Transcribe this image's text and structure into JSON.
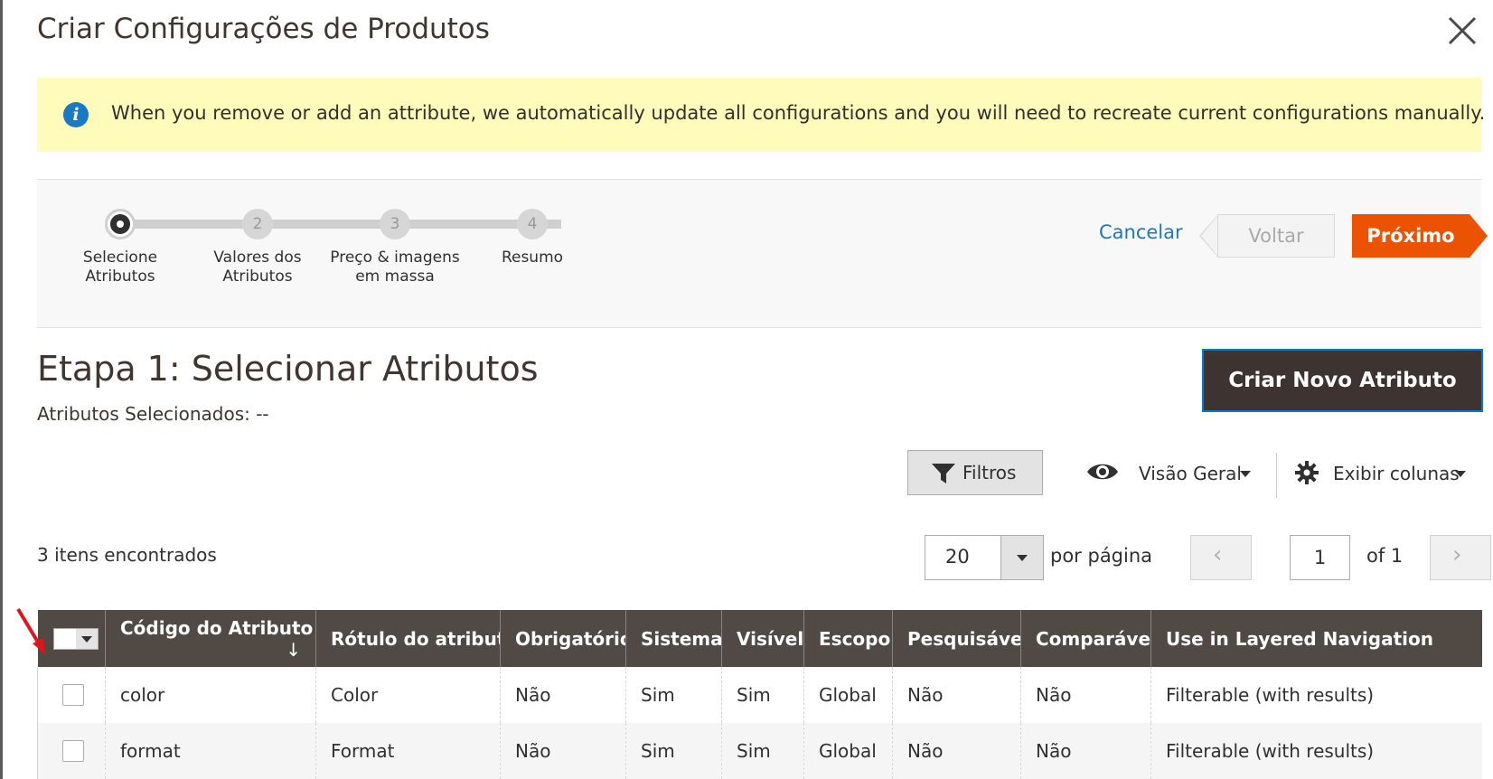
{
  "modal": {
    "title": "Criar Configurações de Produtos"
  },
  "notice": {
    "text": "When you remove or add an attribute, we automatically update all configurations and you will need to recreate current configurations manually."
  },
  "wizard": {
    "steps": [
      {
        "number": "1",
        "label": "Selecione Atributos",
        "active": true
      },
      {
        "number": "2",
        "label": "Valores dos Atributos",
        "active": false
      },
      {
        "number": "3",
        "label": "Preço & imagens em massa",
        "active": false
      },
      {
        "number": "4",
        "label": "Resumo",
        "active": false
      }
    ],
    "cancel_label": "Cancelar",
    "back_label": "Voltar",
    "next_label": "Próximo"
  },
  "step": {
    "title": "Etapa 1: Selecionar Atributos",
    "selected_label": "Atributos Selecionados: --",
    "create_button": "Criar Novo Atributo"
  },
  "toolbar": {
    "filters_label": "Filtros",
    "view_label": "Visão Geral",
    "columns_label": "Exibir colunas"
  },
  "pager": {
    "records": "3 itens encontrados",
    "per_page_value": "20",
    "per_page_label": "por página",
    "current_page": "1",
    "total_pages": "of 1"
  },
  "grid": {
    "columns": [
      "Código do Atributo",
      "Rótulo do atributo",
      "Obrigatório",
      "Sistema",
      "Visível",
      "Escopo",
      "Pesquisável",
      "Comparável",
      "Use in Layered Navigation"
    ],
    "sort_indicator": "↓",
    "rows": [
      [
        "color",
        "Color",
        "Não",
        "Sim",
        "Sim",
        "Global",
        "Não",
        "Não",
        "Filterable (with results)"
      ],
      [
        "format",
        "Format",
        "Não",
        "Sim",
        "Sim",
        "Global",
        "Não",
        "Não",
        "Filterable (with results)"
      ]
    ]
  },
  "icons": {
    "close": "close-icon",
    "info": "info-icon",
    "filter": "funnel-icon",
    "view": "eye-icon",
    "columns": "gear-icon",
    "prev": "chevron-left-icon",
    "next": "chevron-right-icon"
  },
  "colors": {
    "accent_orange": "#eb5202",
    "link_blue": "#1979c3",
    "header_brown": "#514943",
    "notice_yellow": "#fffbbb",
    "create_button_bg": "#3d3330"
  }
}
